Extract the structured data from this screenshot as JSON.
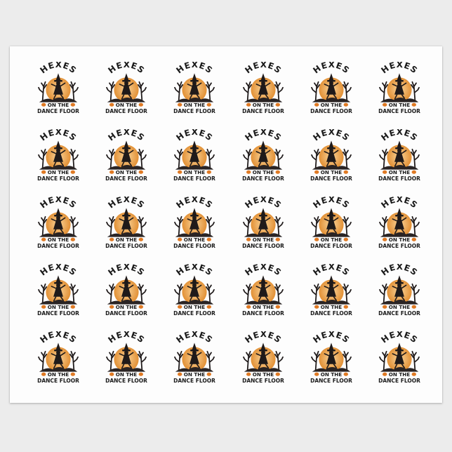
{
  "design": {
    "title_line": "HEXES",
    "line_two": "ON THE",
    "line_three": "DANCE FLOOR",
    "colors": {
      "sheet": "#fdfdfd",
      "background": "#ececec",
      "moon_inner": "#f9d49a",
      "moon_outer": "#e08a2c",
      "silhouette": "#1f1a1a",
      "ground": "#2a2424",
      "text": "#1a1a1a",
      "pumpkin": "#e07a24"
    }
  },
  "grid": {
    "rows": 5,
    "columns": 6
  }
}
